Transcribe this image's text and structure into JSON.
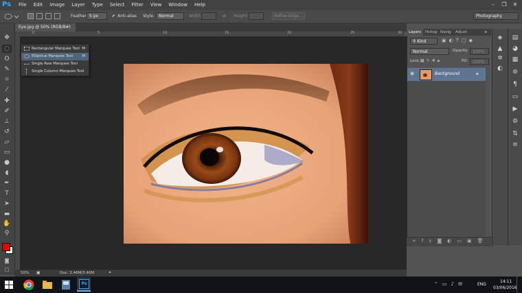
{
  "app": {
    "logo": "Ps"
  },
  "menu": [
    "File",
    "Edit",
    "Image",
    "Layer",
    "Type",
    "Select",
    "Filter",
    "View",
    "Window",
    "Help"
  ],
  "window_controls": {
    "minimize": "–",
    "restore": "❐",
    "close": "✕"
  },
  "options": {
    "feather_label": "Feather:",
    "feather_value": "5 px",
    "antialias_label": "Anti-alias",
    "style_label": "Style:",
    "style_value": "Normal",
    "width_label": "Width:",
    "height_label": "Height:",
    "refine_edge": "Refine Edge...",
    "workspace": "Photography"
  },
  "document": {
    "tab_title": "Eye.jpg @ 50% (RGB/8#)",
    "close": "×",
    "zoom": "50%",
    "doc_info": "Doc: 3.46M/3.46M"
  },
  "ruler_numbers": [
    "0",
    "5",
    "10",
    "15",
    "20",
    "25",
    "30"
  ],
  "flyout": {
    "items": [
      {
        "label": "Rectangular Marquee Tool",
        "key": "M",
        "selected": false,
        "icon": "rect-marquee-icon"
      },
      {
        "label": "Elliptical Marquee Tool",
        "key": "M",
        "selected": true,
        "icon": "ellipse-marquee-icon"
      },
      {
        "label": "Single Row Marquee Tool",
        "key": "",
        "selected": false,
        "icon": "row-marquee-icon"
      },
      {
        "label": "Single Column Marquee Tool",
        "key": "",
        "selected": false,
        "icon": "column-marquee-icon"
      }
    ]
  },
  "panel": {
    "tabs": [
      "Layers",
      "Histog",
      "Navig",
      "Adjust"
    ],
    "kind_label": "Kind",
    "blend_mode": "Normal",
    "opacity_label": "Opacity:",
    "opacity_value": "100%",
    "lock_label": "Lock:",
    "fill_label": "Fill:",
    "fill_value": "100%",
    "layer_name": "Background"
  },
  "taskbar": {
    "language": "ENG",
    "time": "14:11",
    "date": "03/06/2016"
  },
  "colors": {
    "foreground": "#e00000",
    "background": "#ffffff",
    "accent": "#31a8ff",
    "selection": "#5e7592"
  }
}
